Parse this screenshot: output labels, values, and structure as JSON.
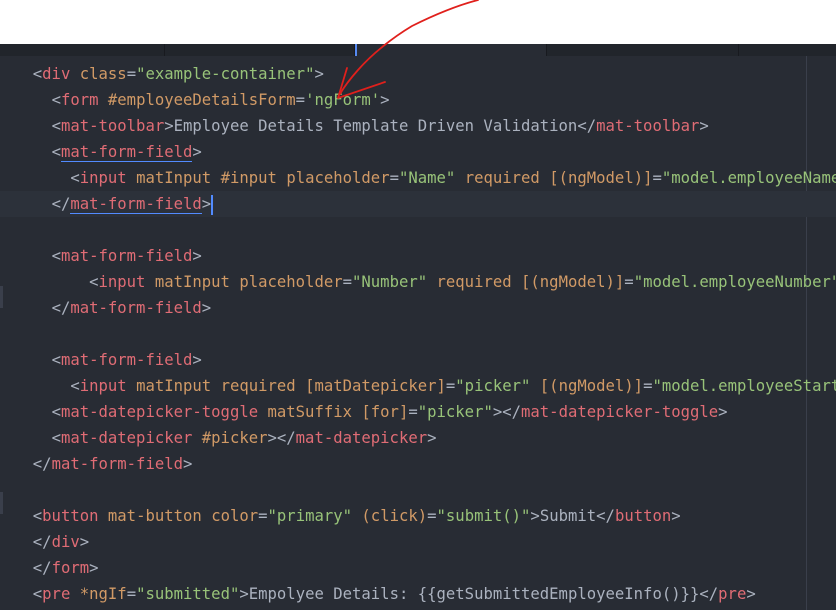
{
  "editor": {
    "tabs": [
      "",
      "",
      "",
      ""
    ],
    "lines": [
      [
        [
          "indent",
          "  "
        ],
        [
          "p",
          "<"
        ],
        [
          "t",
          "div"
        ],
        [
          "p",
          " "
        ],
        [
          "a",
          "class"
        ],
        [
          "p",
          "="
        ],
        [
          "s",
          "\"example-container\""
        ],
        [
          "p",
          ">"
        ]
      ],
      [
        [
          "indent",
          "    "
        ],
        [
          "p",
          "<"
        ],
        [
          "t",
          "form"
        ],
        [
          "p",
          " "
        ],
        [
          "a",
          "#employeeDetailsForm"
        ],
        [
          "p",
          "="
        ],
        [
          "s",
          "'ngForm'"
        ],
        [
          "p",
          ">"
        ]
      ],
      [
        [
          "indent",
          "    "
        ],
        [
          "p",
          "<"
        ],
        [
          "t",
          "mat-toolbar"
        ],
        [
          "p",
          ">"
        ],
        [
          "tx",
          "Employee Details Template Driven Validation"
        ],
        [
          "p",
          "</"
        ],
        [
          "t",
          "mat-toolbar"
        ],
        [
          "p",
          ">"
        ]
      ],
      [
        [
          "indent",
          "    "
        ],
        [
          "p",
          "<"
        ],
        [
          "th",
          "mat-form-field"
        ],
        [
          "p",
          ">"
        ]
      ],
      [
        [
          "indent",
          "      "
        ],
        [
          "p",
          "<"
        ],
        [
          "t",
          "input"
        ],
        [
          "p",
          " "
        ],
        [
          "a",
          "matInput"
        ],
        [
          "p",
          " "
        ],
        [
          "a",
          "#input"
        ],
        [
          "p",
          " "
        ],
        [
          "a",
          "placeholder"
        ],
        [
          "p",
          "="
        ],
        [
          "s",
          "\"Name\""
        ],
        [
          "p",
          " "
        ],
        [
          "a",
          "required"
        ],
        [
          "p",
          " "
        ],
        [
          "a",
          "[(ngModel)]"
        ],
        [
          "p",
          "="
        ],
        [
          "s",
          "\"model.employeeName\""
        ]
      ],
      [
        [
          "indent",
          "    "
        ],
        [
          "p",
          "</"
        ],
        [
          "th",
          "mat-form-field"
        ],
        [
          "p",
          ">"
        ],
        [
          "cursor",
          ""
        ]
      ],
      [],
      [
        [
          "indent",
          "    "
        ],
        [
          "p",
          "<"
        ],
        [
          "t",
          "mat-form-field"
        ],
        [
          "p",
          ">"
        ]
      ],
      [
        [
          "indent",
          "        "
        ],
        [
          "p",
          "<"
        ],
        [
          "t",
          "input"
        ],
        [
          "p",
          " "
        ],
        [
          "a",
          "matInput"
        ],
        [
          "p",
          " "
        ],
        [
          "a",
          "placeholder"
        ],
        [
          "p",
          "="
        ],
        [
          "s",
          "\"Number\""
        ],
        [
          "p",
          " "
        ],
        [
          "a",
          "required"
        ],
        [
          "p",
          " "
        ],
        [
          "a",
          "[(ngModel)]"
        ],
        [
          "p",
          "="
        ],
        [
          "s",
          "\"model.employeeNumber\""
        ]
      ],
      [
        [
          "indent",
          "    "
        ],
        [
          "p",
          "</"
        ],
        [
          "t",
          "mat-form-field"
        ],
        [
          "p",
          ">"
        ]
      ],
      [],
      [
        [
          "indent",
          "    "
        ],
        [
          "p",
          "<"
        ],
        [
          "t",
          "mat-form-field"
        ],
        [
          "p",
          ">"
        ]
      ],
      [
        [
          "indent",
          "      "
        ],
        [
          "p",
          "<"
        ],
        [
          "t",
          "input"
        ],
        [
          "p",
          " "
        ],
        [
          "a",
          "matInput"
        ],
        [
          "p",
          " "
        ],
        [
          "a",
          "required"
        ],
        [
          "p",
          " "
        ],
        [
          "a",
          "[matDatepicker]"
        ],
        [
          "p",
          "="
        ],
        [
          "s",
          "\"picker\""
        ],
        [
          "p",
          " "
        ],
        [
          "a",
          "[(ngModel)]"
        ],
        [
          "p",
          "="
        ],
        [
          "s",
          "\"model.employeeStartDate\""
        ]
      ],
      [
        [
          "indent",
          "    "
        ],
        [
          "p",
          "<"
        ],
        [
          "t",
          "mat-datepicker-toggle"
        ],
        [
          "p",
          " "
        ],
        [
          "a",
          "matSuffix"
        ],
        [
          "p",
          " "
        ],
        [
          "a",
          "[for]"
        ],
        [
          "p",
          "="
        ],
        [
          "s",
          "\"picker\""
        ],
        [
          "p",
          "></"
        ],
        [
          "t",
          "mat-datepicker-toggle"
        ],
        [
          "p",
          ">"
        ]
      ],
      [
        [
          "indent",
          "    "
        ],
        [
          "p",
          "<"
        ],
        [
          "t",
          "mat-datepicker"
        ],
        [
          "p",
          " "
        ],
        [
          "a",
          "#picker"
        ],
        [
          "p",
          "></"
        ],
        [
          "t",
          "mat-datepicker"
        ],
        [
          "p",
          ">"
        ]
      ],
      [
        [
          "indent",
          "  "
        ],
        [
          "p",
          "</"
        ],
        [
          "t",
          "mat-form-field"
        ],
        [
          "p",
          ">"
        ]
      ],
      [],
      [
        [
          "indent",
          "  "
        ],
        [
          "p",
          "<"
        ],
        [
          "t",
          "button"
        ],
        [
          "p",
          " "
        ],
        [
          "a",
          "mat-button"
        ],
        [
          "p",
          " "
        ],
        [
          "a",
          "color"
        ],
        [
          "p",
          "="
        ],
        [
          "s",
          "\"primary\""
        ],
        [
          "p",
          " "
        ],
        [
          "a",
          "(click)"
        ],
        [
          "p",
          "="
        ],
        [
          "s",
          "\"submit()\""
        ],
        [
          "p",
          ">"
        ],
        [
          "tx",
          "Submit"
        ],
        [
          "p",
          "</"
        ],
        [
          "t",
          "button"
        ],
        [
          "p",
          ">"
        ]
      ],
      [
        [
          "indent",
          "  "
        ],
        [
          "p",
          "</"
        ],
        [
          "t",
          "div"
        ],
        [
          "p",
          ">"
        ]
      ],
      [
        [
          "indent",
          "  "
        ],
        [
          "p",
          "</"
        ],
        [
          "t",
          "form"
        ],
        [
          "p",
          ">"
        ]
      ],
      [
        [
          "indent",
          "  "
        ],
        [
          "p",
          "<"
        ],
        [
          "t",
          "pre"
        ],
        [
          "p",
          " "
        ],
        [
          "a",
          "*ngIf"
        ],
        [
          "p",
          "="
        ],
        [
          "s",
          "\"submitted\""
        ],
        [
          "p",
          ">"
        ],
        [
          "tx",
          "Empolyee Details: {{getSubmittedEmployeeInfo()}}"
        ],
        [
          "p",
          "</"
        ],
        [
          "t",
          "pre"
        ],
        [
          "p",
          ">"
        ]
      ]
    ],
    "current_line": 5
  },
  "colors": {
    "background": "#282c34",
    "tag": "#e06c75",
    "attribute": "#d19a66",
    "string": "#98c379",
    "text": "#abb2bf",
    "annotation": "#e0201c"
  }
}
